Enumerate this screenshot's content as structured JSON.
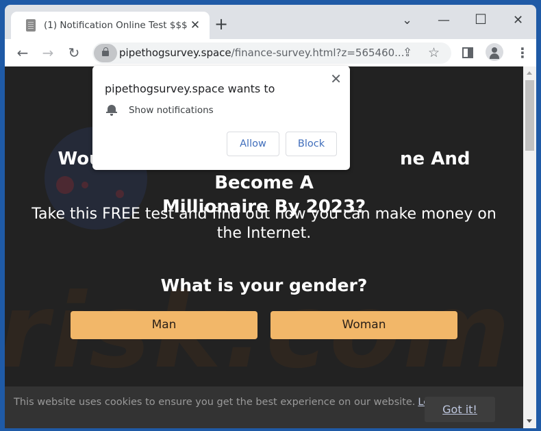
{
  "browser": {
    "tab": {
      "title": "(1) Notification Online Test $$$",
      "favicon": "document-icon",
      "close_glyph": "✕"
    },
    "new_tab_glyph": "+",
    "window_controls": {
      "tab_search": "⌄",
      "minimize": "—",
      "maximize": "☐",
      "close": "✕"
    },
    "nav": {
      "back": "←",
      "forward": "→",
      "reload": "↻"
    },
    "address": {
      "domain": "pipethogsurvey.space",
      "path": "/finance-survey.html?z=565460..."
    },
    "toolbar_icons": {
      "share": "⇪",
      "bookmark": "☆",
      "menu": "⋮"
    }
  },
  "permission_popup": {
    "title": "pipethogsurvey.space wants to",
    "permission": "Show notifications",
    "close_glyph": "✕",
    "allow_label": "Allow",
    "block_label": "Block"
  },
  "page": {
    "headline_left": "Would Y",
    "headline_right": "ne And Become A",
    "headline_line2": "Millionaire By 2023?",
    "subline": "Take this FREE test and find out how you can make money on the Internet.",
    "question": "What is your gender?",
    "choices": [
      "Man",
      "Woman"
    ],
    "watermark": "risk.com",
    "cookie_banner": {
      "text": "This website uses cookies to ensure you get the best experience on our website.",
      "link": "Learn more",
      "button": "Got it!"
    }
  },
  "colors": {
    "page_bg": "#222222",
    "choice_bg": "#f2b769",
    "popup_button_text": "#3f6dbb",
    "window_frame": "#1f5aa6"
  }
}
